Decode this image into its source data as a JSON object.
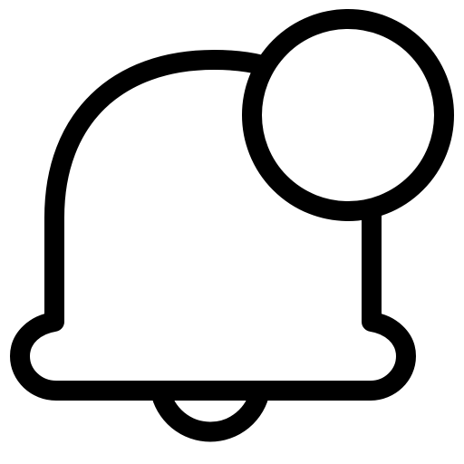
{
  "icon": {
    "name": "notification-bell-icon",
    "parts": [
      "bell-body",
      "bell-clapper",
      "notification-dot"
    ],
    "stroke_color": "#000000",
    "fill_color": "#ffffff",
    "background": "#ffffff"
  }
}
